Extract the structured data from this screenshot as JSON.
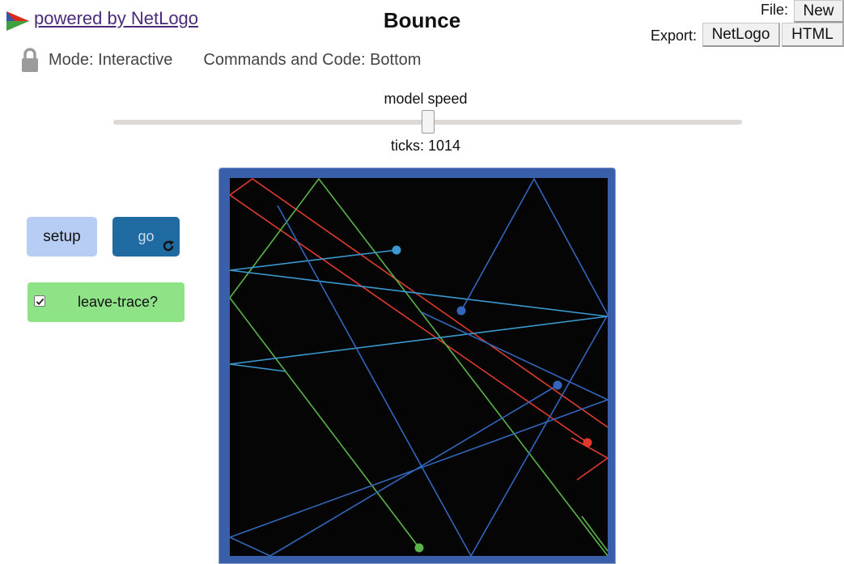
{
  "header": {
    "powered_by": "powered by NetLogo",
    "title": "Bounce",
    "file_label": "File:",
    "new_button": "New",
    "export_label": "Export:",
    "export_netlogo": "NetLogo",
    "export_html": "HTML"
  },
  "mode_bar": {
    "mode": "Mode: Interactive",
    "commands_and_code": "Commands and Code: Bottom"
  },
  "speed": {
    "label": "model speed",
    "ticks": "ticks: 1014",
    "value_fraction": 0.5
  },
  "widgets": {
    "setup_label": "setup",
    "go_label": "go",
    "switch_label": "leave-trace?",
    "switch_checked": true
  },
  "colors": {
    "world_bg": "#050505",
    "view_border": "#3a5faa",
    "setup_bg": "#b8cdf3",
    "go_bg": "#1f6aa0",
    "switch_bg": "#8ee386",
    "turtle_red": "#e03a2e",
    "turtle_green": "#5bb44a",
    "turtle_blue": "#3366bb",
    "turtle_cyan": "#3a9ad0"
  },
  "icons": {
    "logo": "netlogo-logo-icon",
    "lock": "lock-icon",
    "forever": "forever-icon"
  }
}
